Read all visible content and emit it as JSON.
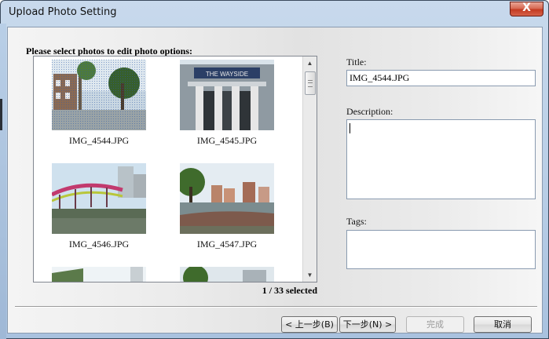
{
  "window": {
    "title": "Upload Photo Setting",
    "close_label": "X"
  },
  "photos": {
    "section_label": "Please select photos to edit photo options:",
    "items": [
      {
        "name": "IMG_4544.JPG"
      },
      {
        "name": "IMG_4545.JPG"
      },
      {
        "name": "IMG_4546.JPG"
      },
      {
        "name": "IMG_4547.JPG"
      }
    ],
    "selected_count": "1 / 33 selected"
  },
  "fields": {
    "title_label": "Title:",
    "title_value": "IMG_4544.JPG",
    "description_label": "Description:",
    "description_value": "",
    "tags_label": "Tags:",
    "tags_value": ""
  },
  "buttons": {
    "back": "< 上一步(B)",
    "next": "下一步(N) >",
    "finish": "完成",
    "cancel": "取消"
  },
  "colors": {
    "frame": "#b7cde6",
    "close": "#c43b22"
  }
}
